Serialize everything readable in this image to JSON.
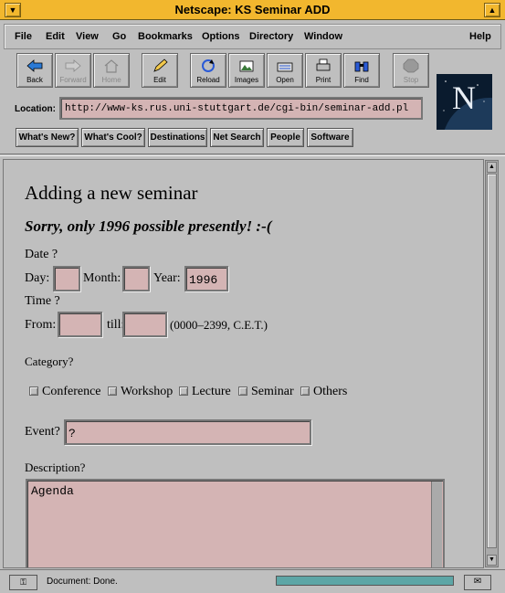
{
  "window": {
    "title": "Netscape: KS Seminar ADD"
  },
  "menubar": {
    "items": [
      "File",
      "Edit",
      "View",
      "Go",
      "Bookmarks",
      "Options",
      "Directory",
      "Window"
    ],
    "help": "Help"
  },
  "toolbar": {
    "back": "Back",
    "forward": "Forward",
    "home": "Home",
    "edit": "Edit",
    "reload": "Reload",
    "images": "Images",
    "open": "Open",
    "print": "Print",
    "find": "Find",
    "stop": "Stop"
  },
  "location": {
    "label": "Location:",
    "url": "http://www-ks.rus.uni-stuttgart.de/cgi-bin/seminar-add.pl"
  },
  "directory_buttons": [
    "What's New?",
    "What's Cool?",
    "Destinations",
    "Net Search",
    "People",
    "Software"
  ],
  "logo": {
    "letter": "N"
  },
  "form": {
    "heading": "Adding a new seminar",
    "subheading": "Sorry, only 1996 possible presently! :-(",
    "date_label": "Date ?",
    "day_label": "Day:",
    "month_label": "Month:",
    "year_label": "Year:",
    "year_value": "1996",
    "time_label": "Time ?",
    "from_label": "From:",
    "till_label": "till:",
    "time_hint": "(0000–2399, C.E.T.)",
    "category_label": "Category?",
    "categories": [
      "Conference",
      "Workshop",
      "Lecture",
      "Seminar",
      "Others"
    ],
    "event_label": "Event?",
    "event_value": "?",
    "description_label": "Description?",
    "description_value": "Agenda"
  },
  "status": {
    "text": "Document: Done."
  }
}
